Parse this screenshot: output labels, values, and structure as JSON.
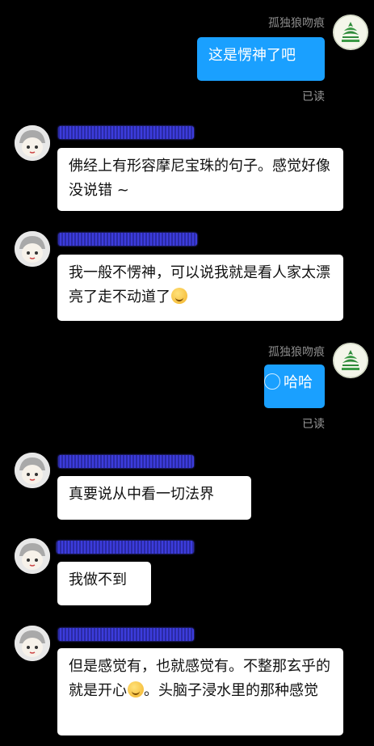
{
  "me": {
    "name": "孤独狼吻痕",
    "avatar_icon": "lotus-logo-icon"
  },
  "messages": [
    {
      "id": "m1",
      "side": "right",
      "text": "这是愣神了吧",
      "status": "已读"
    },
    {
      "id": "m2",
      "side": "left",
      "text": "佛经上有形容摩尼宝珠的句子。感觉好像没说错 ~"
    },
    {
      "id": "m3",
      "side": "left",
      "text": "我一般不愣神，可以说我就是看人家太漂亮了走不动道了",
      "emoji": "dizzy-face-emoji"
    },
    {
      "id": "m4",
      "side": "right",
      "text": "哈哈",
      "status": "已读"
    },
    {
      "id": "m5",
      "side": "left",
      "text": "真要说从中看一切法界"
    },
    {
      "id": "m6",
      "side": "left",
      "text": "我做不到"
    },
    {
      "id": "m7",
      "side": "left",
      "text_before": "但是感觉有，也就感觉有。不整那玄乎的就是开心",
      "emoji": "grinning-face-emoji",
      "text_after": "。头脑子浸水里的那种感觉"
    }
  ],
  "colors": {
    "background": "#000000",
    "outgoing_bubble": "#1aa0ff",
    "incoming_bubble": "#ffffff",
    "name_blur": "#3b3bd6"
  }
}
